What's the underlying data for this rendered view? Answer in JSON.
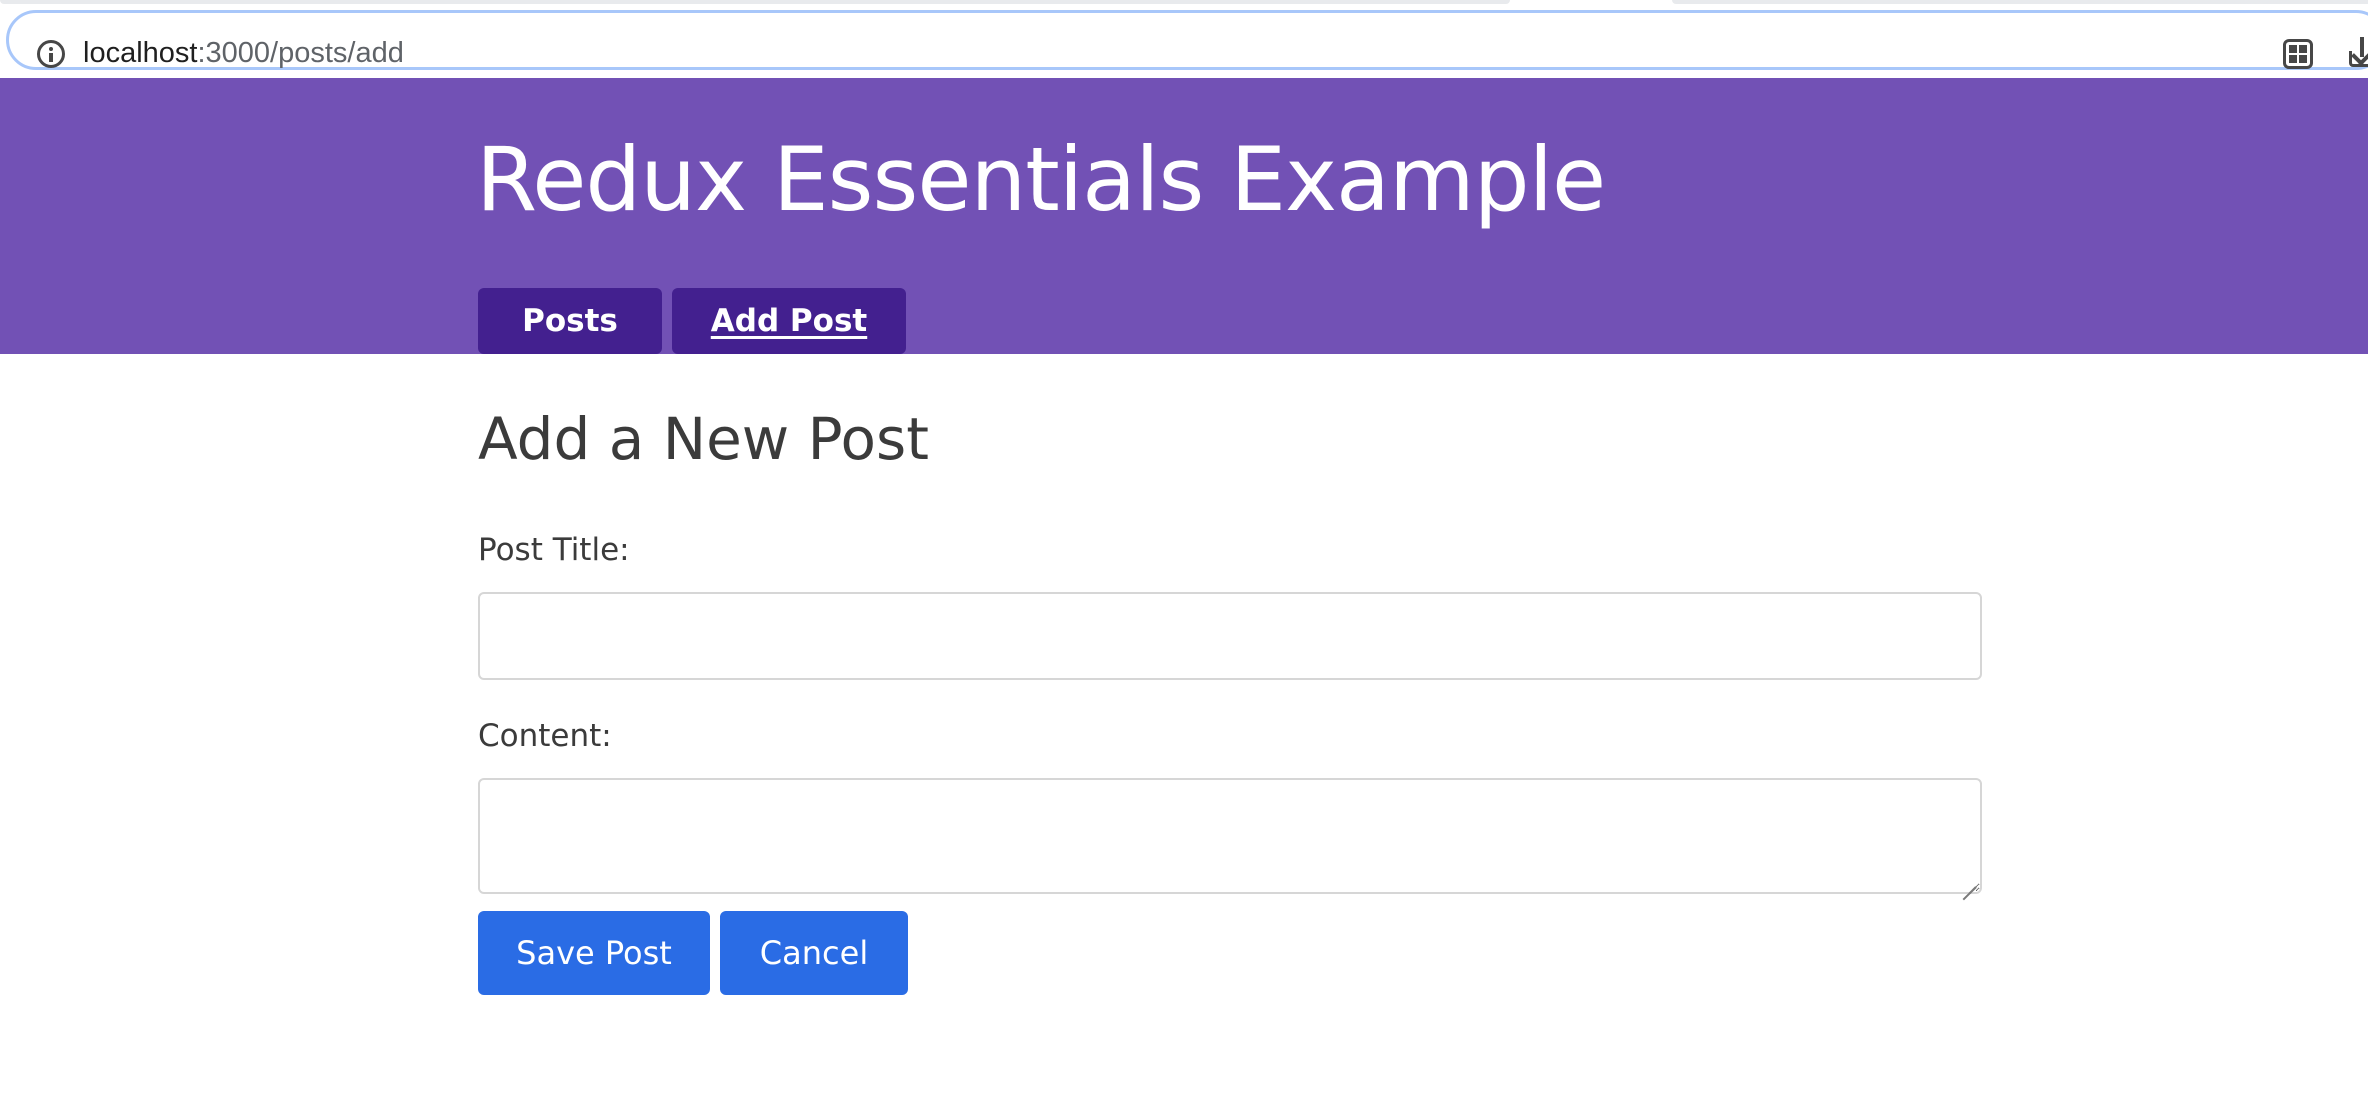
{
  "browser": {
    "url_host": "localhost",
    "url_path": ":3000/posts/add"
  },
  "header": {
    "title": "Redux Essentials Example",
    "nav": {
      "posts_label": "Posts",
      "add_post_label": "Add Post"
    }
  },
  "form": {
    "heading": "Add a New Post",
    "title_label": "Post Title:",
    "title_value": "",
    "content_label": "Content:",
    "content_value": "",
    "save_label": "Save Post",
    "cancel_label": "Cancel"
  },
  "colors": {
    "header_bg": "#7251b5",
    "nav_button_bg": "#43208f",
    "primary_button_bg": "#2a6ce5",
    "heading_text": "#3b3b3b"
  },
  "icons": {
    "site_info": "info-icon",
    "qr_code": "qr-code-icon",
    "install_app": "install-app-icon",
    "textarea_resize": "resize-grip-icon"
  }
}
